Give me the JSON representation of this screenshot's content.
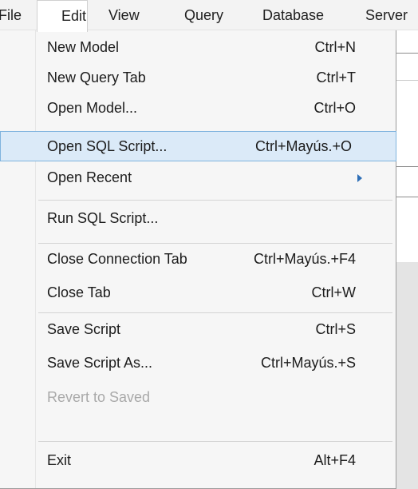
{
  "menubar": {
    "items": [
      {
        "label": "File"
      },
      {
        "label": "Edit"
      },
      {
        "label": "View"
      },
      {
        "label": "Query"
      },
      {
        "label": "Database"
      },
      {
        "label": "Server"
      }
    ]
  },
  "file_menu": {
    "items": [
      {
        "label": "New Model",
        "shortcut": "Ctrl+N"
      },
      {
        "label": "New Query Tab",
        "shortcut": "Ctrl+T"
      },
      {
        "label": "Open Model...",
        "shortcut": "Ctrl+O"
      },
      {
        "label": "Open SQL Script...",
        "shortcut": "Ctrl+Mayús.+O",
        "highlighted": true
      },
      {
        "label": "Open Recent",
        "shortcut": "",
        "submenu": true
      },
      {
        "label": "Run SQL Script...",
        "shortcut": ""
      },
      {
        "label": "Close Connection Tab",
        "shortcut": "Ctrl+Mayús.+F4"
      },
      {
        "label": "Close Tab",
        "shortcut": "Ctrl+W"
      },
      {
        "label": "Save Script",
        "shortcut": "Ctrl+S"
      },
      {
        "label": "Save Script As...",
        "shortcut": "Ctrl+Mayús.+S"
      },
      {
        "label": "Revert to Saved",
        "shortcut": "",
        "disabled": true
      },
      {
        "label": "Exit",
        "shortcut": "Alt+F4"
      }
    ]
  },
  "colors": {
    "highlight_bg": "#dbeaf8",
    "highlight_border": "#7fb3de",
    "disabled_text": "#a9a9a9",
    "submenu_arrow": "#2e6fb7"
  },
  "icons": {
    "submenu": "chevron-right-icon"
  }
}
